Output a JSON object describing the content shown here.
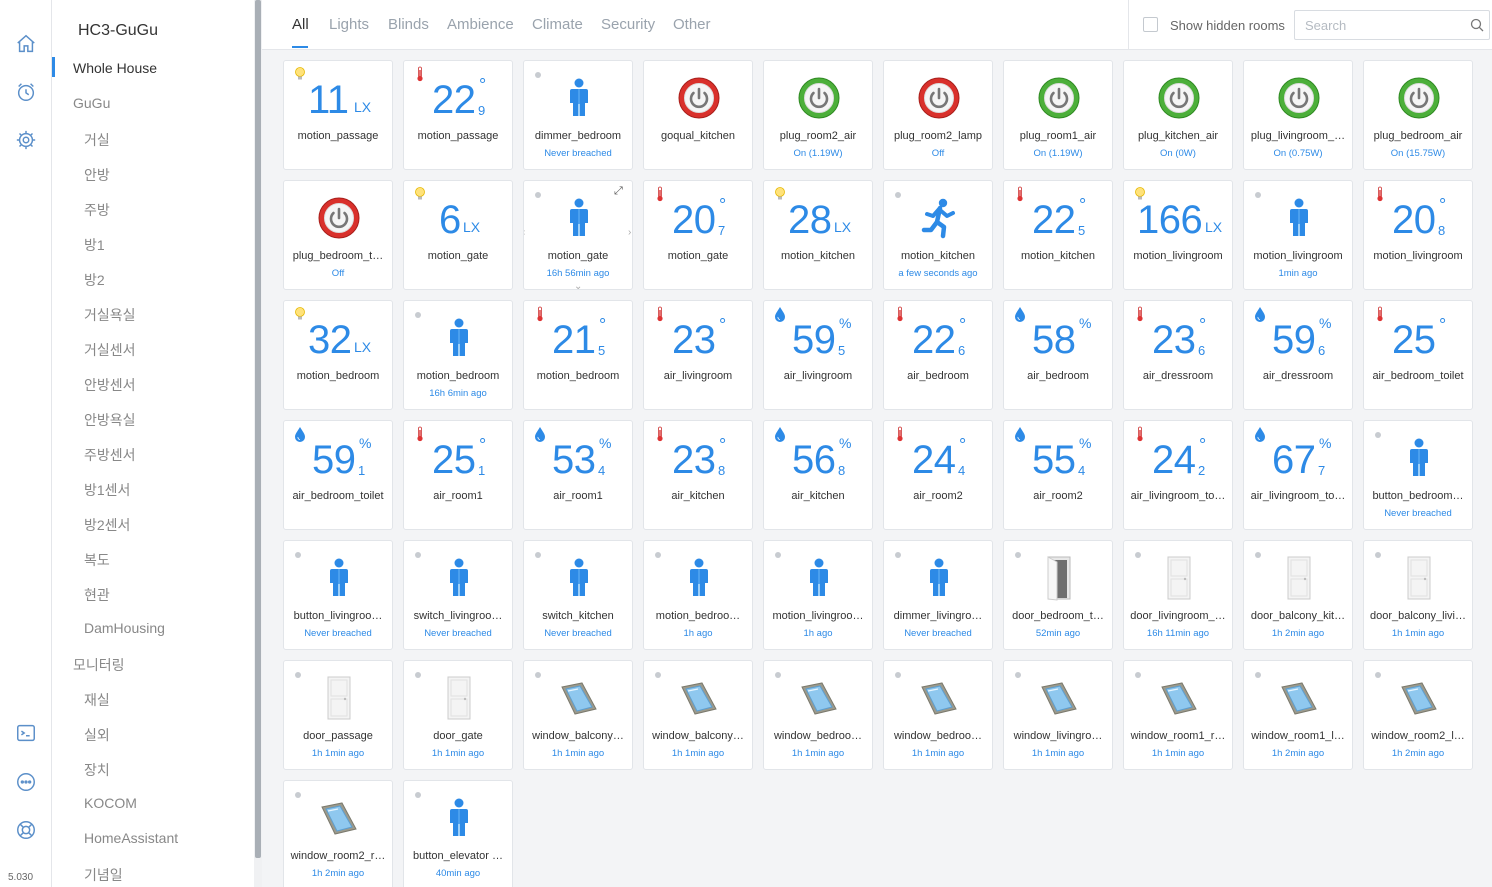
{
  "app": {
    "title": "HC3-GuGu",
    "version": "5.030"
  },
  "rail": [
    {
      "name": "home-icon"
    },
    {
      "name": "scenes-icon"
    },
    {
      "name": "settings-icon"
    },
    {
      "name": "terminal-icon"
    },
    {
      "name": "integrations-icon"
    },
    {
      "name": "support-icon"
    }
  ],
  "rooms": [
    {
      "label": "Whole House",
      "indent": 0,
      "active": true
    },
    {
      "label": "GuGu",
      "indent": 0
    },
    {
      "label": "거실",
      "indent": 1
    },
    {
      "label": "안방",
      "indent": 1
    },
    {
      "label": "주방",
      "indent": 1
    },
    {
      "label": "방1",
      "indent": 1
    },
    {
      "label": "방2",
      "indent": 1
    },
    {
      "label": "거실욕실",
      "indent": 1
    },
    {
      "label": "거실센서",
      "indent": 1
    },
    {
      "label": "안방센서",
      "indent": 1
    },
    {
      "label": "안방욕실",
      "indent": 1
    },
    {
      "label": "주방센서",
      "indent": 1
    },
    {
      "label": "방1센서",
      "indent": 1
    },
    {
      "label": "방2센서",
      "indent": 1
    },
    {
      "label": "복도",
      "indent": 1
    },
    {
      "label": "현관",
      "indent": 1
    },
    {
      "label": "DamHousing",
      "indent": 1
    },
    {
      "label": "모니터링",
      "indent": 0
    },
    {
      "label": "재실",
      "indent": 1
    },
    {
      "label": "실외",
      "indent": 1
    },
    {
      "label": "장치",
      "indent": 1
    },
    {
      "label": "KOCOM",
      "indent": 1
    },
    {
      "label": "HomeAssistant",
      "indent": 1
    },
    {
      "label": "기념일",
      "indent": 1
    }
  ],
  "tabs": [
    {
      "label": "All",
      "active": true
    },
    {
      "label": "Lights"
    },
    {
      "label": "Blinds"
    },
    {
      "label": "Ambience"
    },
    {
      "label": "Climate"
    },
    {
      "label": "Security"
    },
    {
      "label": "Other"
    }
  ],
  "filters": {
    "show_hidden_label": "Show hidden rooms",
    "show_hidden_checked": false,
    "search_placeholder": "Search"
  },
  "colors": {
    "accent": "#2d8ae6",
    "plug_on": "#4caf3a",
    "plug_off": "#d9302b"
  },
  "devices": [
    {
      "name": "motion_passage",
      "kind": "lux",
      "value": "11",
      "unit": "LX"
    },
    {
      "name": "motion_passage",
      "kind": "temp",
      "value": "22",
      "decimal": "9",
      "unit": "°"
    },
    {
      "name": "dimmer_bedroom",
      "kind": "person",
      "status": "Never breached"
    },
    {
      "name": "goqual_kitchen",
      "kind": "plug",
      "on": false,
      "status": ""
    },
    {
      "name": "plug_room2_air",
      "kind": "plug",
      "on": true,
      "status": "On (1.19W)"
    },
    {
      "name": "plug_room2_lamp",
      "kind": "plug",
      "on": false,
      "status": "Off"
    },
    {
      "name": "plug_room1_air",
      "kind": "plug",
      "on": true,
      "status": "On (1.19W)"
    },
    {
      "name": "plug_kitchen_air",
      "kind": "plug",
      "on": true,
      "status": "On (0W)"
    },
    {
      "name": "plug_livingroom_…",
      "kind": "plug",
      "on": true,
      "status": "On (0.75W)"
    },
    {
      "name": "plug_bedroom_air",
      "kind": "plug",
      "on": true,
      "status": "On (15.75W)"
    },
    {
      "name": "plug_bedroom_t…",
      "kind": "plug",
      "on": false,
      "status": "Off"
    },
    {
      "name": "motion_gate",
      "kind": "lux",
      "value": "6",
      "unit": "LX"
    },
    {
      "name": "motion_gate",
      "kind": "person",
      "status": "16h 56min ago",
      "hovered": true
    },
    {
      "name": "motion_gate",
      "kind": "temp",
      "value": "20",
      "decimal": "7",
      "unit": "°"
    },
    {
      "name": "motion_kitchen",
      "kind": "lux",
      "value": "28",
      "unit": "LX"
    },
    {
      "name": "motion_kitchen",
      "kind": "runner",
      "status": "a few seconds ago"
    },
    {
      "name": "motion_kitchen",
      "kind": "temp",
      "value": "22",
      "decimal": "5",
      "unit": "°"
    },
    {
      "name": "motion_livingroom",
      "kind": "lux",
      "value": "166",
      "unit": "LX"
    },
    {
      "name": "motion_livingroom",
      "kind": "person",
      "status": "1min ago"
    },
    {
      "name": "motion_livingroom",
      "kind": "temp",
      "value": "20",
      "decimal": "8",
      "unit": "°"
    },
    {
      "name": "motion_bedroom",
      "kind": "lux",
      "value": "32",
      "unit": "LX"
    },
    {
      "name": "motion_bedroom",
      "kind": "person",
      "status": "16h 6min ago"
    },
    {
      "name": "motion_bedroom",
      "kind": "temp",
      "value": "21",
      "decimal": "5",
      "unit": "°"
    },
    {
      "name": "air_livingroom",
      "kind": "temp",
      "value": "23",
      "unit": "°"
    },
    {
      "name": "air_livingroom",
      "kind": "hum",
      "value": "59",
      "decimal": "5",
      "unit": "%"
    },
    {
      "name": "air_bedroom",
      "kind": "temp",
      "value": "22",
      "decimal": "6",
      "unit": "°"
    },
    {
      "name": "air_bedroom",
      "kind": "hum",
      "value": "58",
      "unit": "%"
    },
    {
      "name": "air_dressroom",
      "kind": "temp",
      "value": "23",
      "decimal": "6",
      "unit": "°"
    },
    {
      "name": "air_dressroom",
      "kind": "hum",
      "value": "59",
      "decimal": "6",
      "unit": "%"
    },
    {
      "name": "air_bedroom_toilet",
      "kind": "temp",
      "value": "25",
      "unit": "°"
    },
    {
      "name": "air_bedroom_toilet",
      "kind": "hum",
      "value": "59",
      "decimal": "1",
      "unit": "%"
    },
    {
      "name": "air_room1",
      "kind": "temp",
      "value": "25",
      "decimal": "1",
      "unit": "°"
    },
    {
      "name": "air_room1",
      "kind": "hum",
      "value": "53",
      "decimal": "4",
      "unit": "%"
    },
    {
      "name": "air_kitchen",
      "kind": "temp",
      "value": "23",
      "decimal": "8",
      "unit": "°"
    },
    {
      "name": "air_kitchen",
      "kind": "hum",
      "value": "56",
      "decimal": "8",
      "unit": "%"
    },
    {
      "name": "air_room2",
      "kind": "temp",
      "value": "24",
      "decimal": "4",
      "unit": "°"
    },
    {
      "name": "air_room2",
      "kind": "hum",
      "value": "55",
      "decimal": "4",
      "unit": "%"
    },
    {
      "name": "air_livingroom_to…",
      "kind": "temp",
      "value": "24",
      "decimal": "2",
      "unit": "°"
    },
    {
      "name": "air_livingroom_to…",
      "kind": "hum",
      "value": "67",
      "decimal": "7",
      "unit": "%"
    },
    {
      "name": "button_bedroom…",
      "kind": "person",
      "status": "Never breached"
    },
    {
      "name": "button_livingroo…",
      "kind": "person",
      "status": "Never breached"
    },
    {
      "name": "switch_livingroo…",
      "kind": "person",
      "status": "Never breached"
    },
    {
      "name": "switch_kitchen",
      "kind": "person",
      "status": "Never breached"
    },
    {
      "name": "motion_bedroo…",
      "kind": "person",
      "status": "1h ago"
    },
    {
      "name": "motion_livingroo…",
      "kind": "person",
      "status": "1h ago"
    },
    {
      "name": "dimmer_livingro…",
      "kind": "person",
      "status": "Never breached"
    },
    {
      "name": "door_bedroom_t…",
      "kind": "door",
      "open": true,
      "status": "52min ago"
    },
    {
      "name": "door_livingroom_…",
      "kind": "door",
      "status": "16h 11min ago"
    },
    {
      "name": "door_balcony_kit…",
      "kind": "door",
      "status": "1h 2min ago"
    },
    {
      "name": "door_balcony_livi…",
      "kind": "door",
      "status": "1h 1min ago"
    },
    {
      "name": "door_passage",
      "kind": "door",
      "status": "1h 1min ago"
    },
    {
      "name": "door_gate",
      "kind": "door",
      "status": "1h 1min ago"
    },
    {
      "name": "window_balcony…",
      "kind": "window",
      "status": "1h 1min ago"
    },
    {
      "name": "window_balcony…",
      "kind": "window",
      "status": "1h 1min ago"
    },
    {
      "name": "window_bedroo…",
      "kind": "window",
      "status": "1h 1min ago"
    },
    {
      "name": "window_bedroo…",
      "kind": "window",
      "status": "1h 1min ago"
    },
    {
      "name": "window_livingro…",
      "kind": "window",
      "status": "1h 1min ago"
    },
    {
      "name": "window_room1_r…",
      "kind": "window",
      "status": "1h 1min ago"
    },
    {
      "name": "window_room1_l…",
      "kind": "window",
      "status": "1h 2min ago"
    },
    {
      "name": "window_room2_l…",
      "kind": "window",
      "status": "1h 2min ago"
    },
    {
      "name": "window_room2_r…",
      "kind": "window",
      "status": "1h 2min ago"
    },
    {
      "name": "button_elevator …",
      "kind": "person",
      "status": "40min ago"
    }
  ]
}
